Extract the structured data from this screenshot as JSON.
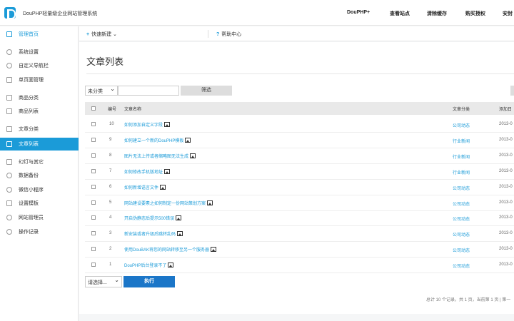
{
  "header": {
    "app_title": "DouPHP轻量级企业网站管理系统",
    "nav": [
      "DouPHP+",
      "查看站点",
      "清除缓存",
      "购买授权",
      "安封"
    ]
  },
  "sidebar": {
    "items": [
      {
        "label": "管理首页",
        "icon": "home-icon"
      },
      {
        "label": "系统设置",
        "icon": "gear-icon"
      },
      {
        "label": "自定义导航栏",
        "icon": "share-icon"
      },
      {
        "label": "单页面管理",
        "icon": "page-icon"
      },
      {
        "label": "商品分类",
        "icon": "category-icon"
      },
      {
        "label": "商品列表",
        "icon": "grid-icon"
      },
      {
        "label": "文章分类",
        "icon": "book-icon"
      },
      {
        "label": "文章列表",
        "icon": "document-icon"
      },
      {
        "label": "幻灯与其它",
        "icon": "slides-icon"
      },
      {
        "label": "数据备份",
        "icon": "backup-icon"
      },
      {
        "label": "微信小程序",
        "icon": "wechat-icon"
      },
      {
        "label": "设置模板",
        "icon": "template-icon"
      },
      {
        "label": "网站管理员",
        "icon": "user-icon"
      },
      {
        "label": "操作记录",
        "icon": "clock-icon"
      }
    ]
  },
  "subbar": {
    "quick_label": "快速新建",
    "help_label": "帮助中心"
  },
  "main": {
    "title": "文章列表",
    "filter": {
      "category": "未分类",
      "button": "筛选"
    },
    "columns": {
      "id": "编号",
      "name": "文章名称",
      "category": "文章分类",
      "date": "添加日"
    },
    "rows": [
      {
        "id": "10",
        "title": "如何添加自定义字段",
        "category": "公司动态",
        "date": "2013-0"
      },
      {
        "id": "9",
        "title": "如何建立一个新的DouPHP模板",
        "category": "行业新闻",
        "date": "2013-0"
      },
      {
        "id": "8",
        "title": "图片无法上传或者缩略图无法生成",
        "category": "行业新闻",
        "date": "2013-0"
      },
      {
        "id": "7",
        "title": "如何修改手机版地址",
        "category": "行业新闻",
        "date": "2013-0"
      },
      {
        "id": "6",
        "title": "如何新增语言文件",
        "category": "公司动态",
        "date": "2013-0"
      },
      {
        "id": "5",
        "title": "网站建设要素之如何制定一份网站策划方案",
        "category": "公司动态",
        "date": "2013-0"
      },
      {
        "id": "4",
        "title": "开启伪静态后提示500错误",
        "category": "公司动态",
        "date": "2013-0"
      },
      {
        "id": "3",
        "title": "新安装或者升级后跳转乱码",
        "category": "公司动态",
        "date": "2013-0"
      },
      {
        "id": "2",
        "title": "使用DouBAK将您的网站转移至另一个服务器",
        "category": "公司动态",
        "date": "2013-0"
      },
      {
        "id": "1",
        "title": "DouPHP后台登录不了",
        "category": "公司动态",
        "date": "2013-0"
      }
    ],
    "batch": {
      "select": "请选择...",
      "button": "执行"
    },
    "pager": "总计 10 个记录，共 1 页，当前第 1 页 | 第一"
  }
}
